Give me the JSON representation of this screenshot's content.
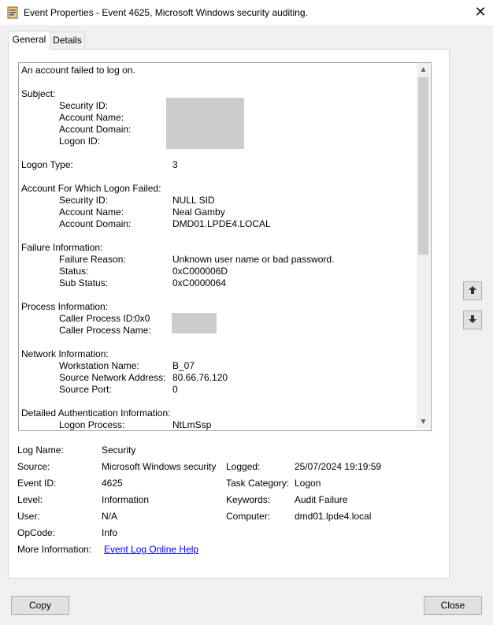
{
  "window": {
    "title": "Event Properties - Event 4625, Microsoft Windows security auditing.",
    "close_glyph": "✕"
  },
  "tabs": [
    {
      "label": "General",
      "selected": true
    },
    {
      "label": "Details",
      "selected": false
    }
  ],
  "description": {
    "intro": "An account failed to log on.",
    "subject": {
      "heading": "Subject:",
      "security_id_label": "Security ID:",
      "account_name_label": "Account Name:",
      "account_domain_label": "Account Domain:",
      "logon_id_label": "Logon ID:"
    },
    "logon_type": {
      "label": "Logon Type:",
      "value": "3"
    },
    "failed_account": {
      "heading": "Account For Which Logon Failed:",
      "security_id_label": "Security ID:",
      "security_id_value": "NULL SID",
      "account_name_label": "Account Name:",
      "account_name_value": "Neal Gamby",
      "account_domain_label": "Account Domain:",
      "account_domain_value": "DMD01.LPDE4.LOCAL"
    },
    "failure": {
      "heading": "Failure Information:",
      "reason_label": "Failure Reason:",
      "reason_value": "Unknown user name or bad password.",
      "status_label": "Status:",
      "status_value": "0xC000006D",
      "sub_status_label": "Sub Status:",
      "sub_status_value": "0xC0000064"
    },
    "process": {
      "heading": "Process Information:",
      "caller_pid_label": "Caller Process ID:",
      "caller_pid_value": "0x0",
      "caller_name_label": "Caller Process Name:"
    },
    "network": {
      "heading": "Network Information:",
      "workstation_label": "Workstation Name:",
      "workstation_value": "B_07",
      "address_label": "Source Network Address:",
      "address_value": "80.66.76.120",
      "port_label": "Source Port:",
      "port_value": "0"
    },
    "auth": {
      "heading": "Detailed Authentication Information:",
      "logon_process_label": "Logon Process:",
      "logon_process_value": "NtLmSsp"
    }
  },
  "details": {
    "log_name_label": "Log Name:",
    "log_name_value": "Security",
    "source_label": "Source:",
    "source_value": "Microsoft Windows security",
    "logged_label": "Logged:",
    "logged_value": "25/07/2024 19:19:59",
    "event_id_label": "Event ID:",
    "event_id_value": "4625",
    "task_category_label": "Task Category:",
    "task_category_value": "Logon",
    "level_label": "Level:",
    "level_value": "Information",
    "keywords_label": "Keywords:",
    "keywords_value": "Audit Failure",
    "user_label": "User:",
    "user_value": "N/A",
    "computer_label": "Computer:",
    "computer_value": "dmd01.lpde4.local",
    "opcode_label": "OpCode:",
    "opcode_value": "Info",
    "more_info_label": "More Information:",
    "more_info_link": "Event Log Online Help"
  },
  "buttons": {
    "copy": "Copy",
    "close": "Close"
  },
  "scroll": {
    "up_glyph": "▲",
    "down_glyph": "▼"
  }
}
